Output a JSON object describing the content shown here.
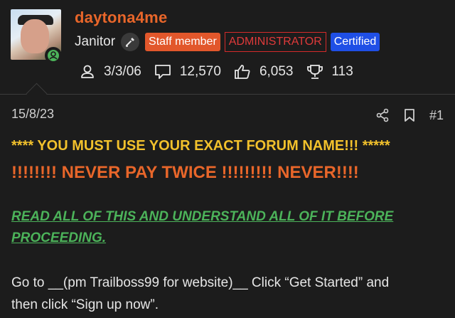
{
  "user": {
    "name": "daytona4me",
    "title": "Janitor",
    "badges": {
      "staff": "Staff member",
      "admin": "ADMINISTRATOR",
      "certified": "Certified"
    },
    "stats": {
      "joined": "3/3/06",
      "messages": "12,570",
      "reactions": "6,053",
      "points": "113"
    }
  },
  "post": {
    "date": "15/8/23",
    "number": "#1",
    "line1": "**** YOU MUST USE YOUR EXACT FORUM NAME!!! *****",
    "line2": "!!!!!!!! NEVER PAY TWICE !!!!!!!!! NEVER!!!!",
    "line3": "READ ALL OF THIS AND UNDERSTAND ALL OF IT BEFORE",
    "line4": "PROCEEDING.",
    "line5": "Go to __(pm Trailboss99 for website)__ Click “Get Started” and",
    "line6": "then click “Sign up now”."
  },
  "colors": {
    "background": "#1c1c1c",
    "username": "#e8662a",
    "warning_yellow": "#f2c12c",
    "warning_orange": "#e8662a",
    "link_green": "#4cb35a",
    "staff_badge": "#e2572b",
    "admin_badge": "#d42a2a",
    "certified_badge": "#1f4fe6"
  },
  "icons": {
    "joined": "user-icon",
    "messages": "message-icon",
    "reactions": "thumbs-up-icon",
    "points": "trophy-icon",
    "share": "share-icon",
    "bookmark": "bookmark-icon",
    "online": "online-status-icon",
    "title": "mop-icon"
  }
}
